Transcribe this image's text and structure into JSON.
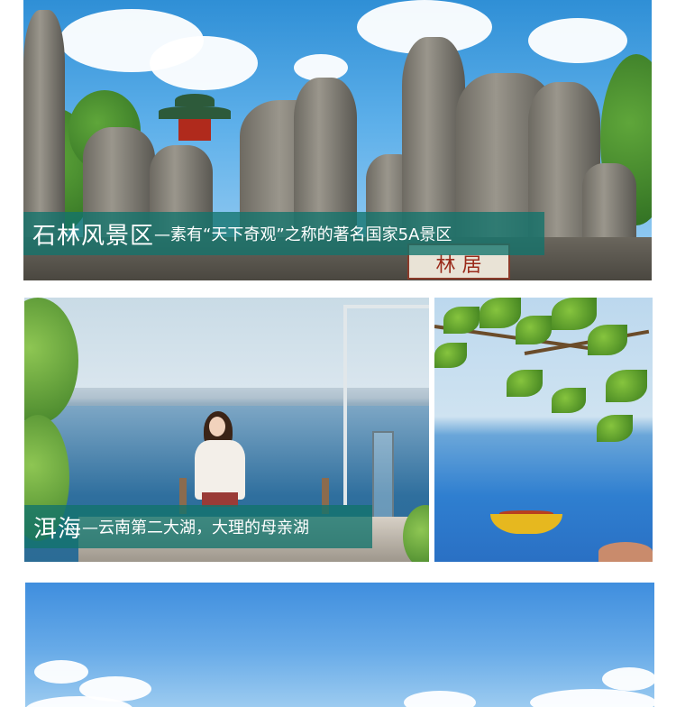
{
  "stone_forest": {
    "title": "石林风景区",
    "subtitle": "—素有“天下奇观”之称的著名国家5A景区",
    "sign_text": "林 居"
  },
  "erhai": {
    "title": "洱海",
    "subtitle": "—云南第二大湖，大理的母亲湖"
  },
  "colors": {
    "banner_overlay": "#12736c",
    "sky_blue": "#3f8ede",
    "lake_blue": "#2f6f9e"
  }
}
